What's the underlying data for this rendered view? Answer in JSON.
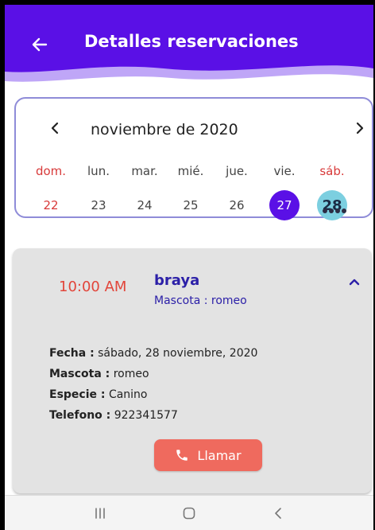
{
  "header": {
    "title": "Detalles reservaciones",
    "back_icon": "arrow-left-icon",
    "color_primary": "#5a10e6",
    "color_secondary": "#8a5cf0"
  },
  "calendar": {
    "month_label": "noviembre de 2020",
    "prev_icon": "chevron-left-icon",
    "next_icon": "chevron-right-icon",
    "weekdays": [
      "dom.",
      "lun.",
      "mar.",
      "mié.",
      "jue.",
      "vie.",
      "sáb."
    ],
    "days": [
      "22",
      "23",
      "24",
      "25",
      "26",
      "27",
      "28"
    ],
    "selected_day": "27",
    "today": "28",
    "event_dot_count": 4,
    "colors": {
      "selected": "#5a10e6",
      "today": "#7ccfe0",
      "weekend": "#d83a3a",
      "border": "#8f8cd8"
    }
  },
  "reservation": {
    "time": "10:00 AM",
    "client_name": "braya",
    "pet_summary": "Mascota : romeo",
    "collapse_icon": "chevron-up-icon",
    "details": [
      {
        "label": "Fecha :",
        "value": "sábado, 28 noviembre, 2020"
      },
      {
        "label": "Mascota :",
        "value": "romeo"
      },
      {
        "label": "Especie :",
        "value": "Canino"
      },
      {
        "label": "Telefono :",
        "value": "922341577"
      }
    ],
    "call_button": {
      "label": "Llamar",
      "icon": "phone-icon",
      "color": "#ef6a5e"
    }
  },
  "navbar": {
    "recents_icon": "recents-icon",
    "home_icon": "home-icon",
    "back_icon": "nav-back-icon"
  }
}
